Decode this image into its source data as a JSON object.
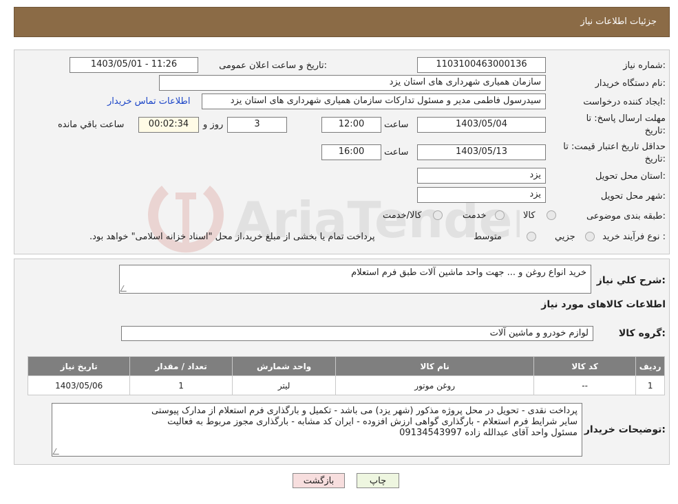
{
  "header": {
    "title": "جزئیات اطلاعات نیاز"
  },
  "info": {
    "need_number_label": "شماره نیاز:",
    "need_number": "1103100463000136",
    "announce_label": "تاریخ و ساعت اعلان عمومی:",
    "announce_value": "1403/05/01 - 11:26",
    "buyer_label": "نام دستگاه خریدار:",
    "buyer_value": "سازمان همیاری شهرداری های استان یزد",
    "creator_label": "ایجاد کننده درخواست:",
    "creator_value": "سیدرسول فاطمی مدیر و مسئول تدارکات سازمان همیاری شهرداری های استان یزد",
    "contact_link": "اطلاعات تماس خریدار",
    "deadline_label_line1": "مهلت ارسال پاسخ: تا",
    "deadline_label_line2": "تاریخ:",
    "deadline_date": "1403/05/04",
    "time_label": "ساعت",
    "deadline_time": "12:00",
    "days_value": "3",
    "days_label": "روز و",
    "remaining_time": "00:02:34",
    "remaining_label": "ساعت باقي مانده",
    "validity_label_line1": "حداقل تاریخ اعتبار قیمت: تا",
    "validity_label_line2": "تاریخ:",
    "validity_date": "1403/05/13",
    "validity_time": "16:00",
    "province_label": "استان محل تحویل:",
    "province_value": "یزد",
    "city_label": "شهر محل تحویل:",
    "city_value": "یزد",
    "category_label": "طبقه بندی موضوعی:",
    "category_options": [
      "کالا",
      "خدمت",
      "کالا/خدمت"
    ],
    "process_label": "نوع فرآیند خرید :",
    "process_options": [
      "جزیي",
      "متوسط"
    ],
    "process_note": "پرداخت تمام یا بخشی از مبلغ خرید،از محل \"اسناد خزانه اسلامی\" خواهد بود."
  },
  "summary": {
    "desc_label": "شرح کلي نیاز:",
    "desc_value": "خرید انواع روغن و ... جهت واحد ماشین آلات طبق فرم استعلام",
    "goods_info_title": "اطلاعات کالاهای مورد نیاز",
    "group_label": "گروه کالا:",
    "group_value": "لوازم خودرو و ماشین آلات"
  },
  "table": {
    "headers": [
      "ردیف",
      "کد کالا",
      "نام کالا",
      "واحد شمارش",
      "تعداد / مقدار",
      "تاریخ نیاز"
    ],
    "rows": [
      [
        "1",
        "--",
        "روغن موتور",
        "لیتر",
        "1",
        "1403/05/06"
      ]
    ]
  },
  "notes": {
    "label": "توضیحات خریدار:",
    "lines": [
      "پرداخت نقدی - تحویل در محل پروژه مذکور (شهر یزد) می باشد - تکمیل و بارگذاری فرم استعلام از مدارک پیوستی",
      "سایر شرایط فرم استعلام - بارگذاری گواهی ارزش افزوده - ایران کد مشابه - بارگذاری مجوز مربوط به فعالیت",
      "مسئول واحد آقای عبدالله زاده 09134543997"
    ]
  },
  "buttons": {
    "print": "چاپ",
    "back": "بازگشت"
  },
  "watermark": {
    "text": "AriaTender.neT"
  },
  "colors": {
    "header_bg": "#8b6b46",
    "table_header": "#7f7f7f",
    "link": "#1a44c7"
  }
}
